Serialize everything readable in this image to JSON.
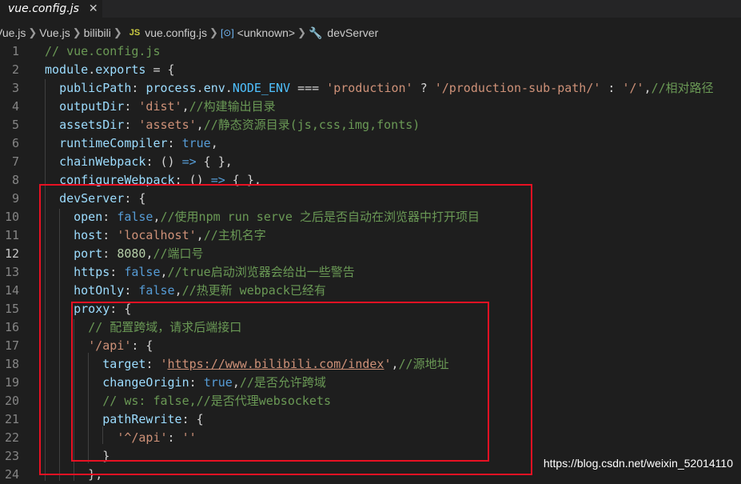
{
  "tab": {
    "title": "vue.config.js",
    "close": "✕"
  },
  "breadcrumb": [
    "Vue.js",
    "Vue.js",
    "bilibili",
    "vue.config.js",
    "<unknown>",
    "devServer"
  ],
  "breadcrumb_icons": {
    "js_badge": "JS",
    "symbol": "[⊙]",
    "wrench": "🔧"
  },
  "active_line": 12,
  "lines": [
    {
      "n": "1",
      "tokens": [
        {
          "t": "// vue.config.js",
          "c": "com"
        }
      ]
    },
    {
      "n": "2",
      "tokens": [
        {
          "t": "module",
          "c": "var"
        },
        {
          "t": ".",
          "c": "p"
        },
        {
          "t": "exports",
          "c": "var"
        },
        {
          "t": " = {",
          "c": "p"
        }
      ]
    },
    {
      "n": "3",
      "tokens": [
        {
          "t": "  ",
          "c": "p"
        },
        {
          "t": "publicPath",
          "c": "var"
        },
        {
          "t": ": ",
          "c": "p"
        },
        {
          "t": "process",
          "c": "var"
        },
        {
          "t": ".",
          "c": "p"
        },
        {
          "t": "env",
          "c": "var"
        },
        {
          "t": ".",
          "c": "p"
        },
        {
          "t": "NODE_ENV",
          "c": "const"
        },
        {
          "t": " === ",
          "c": "p"
        },
        {
          "t": "'production'",
          "c": "str"
        },
        {
          "t": " ? ",
          "c": "p"
        },
        {
          "t": "'/production-sub-path/'",
          "c": "str"
        },
        {
          "t": " : ",
          "c": "p"
        },
        {
          "t": "'/'",
          "c": "str"
        },
        {
          "t": ",",
          "c": "p"
        },
        {
          "t": "//相对路径",
          "c": "com"
        }
      ]
    },
    {
      "n": "4",
      "tokens": [
        {
          "t": "  ",
          "c": "p"
        },
        {
          "t": "outputDir",
          "c": "var"
        },
        {
          "t": ": ",
          "c": "p"
        },
        {
          "t": "'dist'",
          "c": "str"
        },
        {
          "t": ",",
          "c": "p"
        },
        {
          "t": "//构建输出目录",
          "c": "com"
        }
      ]
    },
    {
      "n": "5",
      "tokens": [
        {
          "t": "  ",
          "c": "p"
        },
        {
          "t": "assetsDir",
          "c": "var"
        },
        {
          "t": ": ",
          "c": "p"
        },
        {
          "t": "'assets'",
          "c": "str"
        },
        {
          "t": ",",
          "c": "p"
        },
        {
          "t": "//静态资源目录(js,css,img,fonts)",
          "c": "com"
        }
      ]
    },
    {
      "n": "6",
      "tokens": [
        {
          "t": "  ",
          "c": "p"
        },
        {
          "t": "runtimeCompiler",
          "c": "var"
        },
        {
          "t": ": ",
          "c": "p"
        },
        {
          "t": "true",
          "c": "kw"
        },
        {
          "t": ",",
          "c": "p"
        }
      ]
    },
    {
      "n": "7",
      "tokens": [
        {
          "t": "  ",
          "c": "p"
        },
        {
          "t": "chainWebpack",
          "c": "var"
        },
        {
          "t": ": () ",
          "c": "p"
        },
        {
          "t": "=>",
          "c": "kw"
        },
        {
          "t": " { },",
          "c": "p"
        }
      ]
    },
    {
      "n": "8",
      "tokens": [
        {
          "t": "  ",
          "c": "p"
        },
        {
          "t": "configureWebpack",
          "c": "var"
        },
        {
          "t": ": () ",
          "c": "p"
        },
        {
          "t": "=>",
          "c": "kw"
        },
        {
          "t": " { },",
          "c": "p"
        }
      ]
    },
    {
      "n": "9",
      "tokens": [
        {
          "t": "  ",
          "c": "p"
        },
        {
          "t": "devServer",
          "c": "var"
        },
        {
          "t": ": {",
          "c": "p"
        }
      ]
    },
    {
      "n": "10",
      "tokens": [
        {
          "t": "    ",
          "c": "p"
        },
        {
          "t": "open",
          "c": "var"
        },
        {
          "t": ": ",
          "c": "p"
        },
        {
          "t": "false",
          "c": "kw"
        },
        {
          "t": ",",
          "c": "p"
        },
        {
          "t": "//使用npm run serve 之后是否自动在浏览器中打开项目",
          "c": "com"
        }
      ]
    },
    {
      "n": "11",
      "tokens": [
        {
          "t": "    ",
          "c": "p"
        },
        {
          "t": "host",
          "c": "var"
        },
        {
          "t": ": ",
          "c": "p"
        },
        {
          "t": "'localhost'",
          "c": "str"
        },
        {
          "t": ",",
          "c": "p"
        },
        {
          "t": "//主机名字",
          "c": "com"
        }
      ]
    },
    {
      "n": "12",
      "tokens": [
        {
          "t": "    ",
          "c": "p"
        },
        {
          "t": "port",
          "c": "var"
        },
        {
          "t": ": ",
          "c": "p"
        },
        {
          "t": "8080",
          "c": "num"
        },
        {
          "t": ",",
          "c": "p"
        },
        {
          "t": "//端口号",
          "c": "com"
        }
      ]
    },
    {
      "n": "13",
      "tokens": [
        {
          "t": "    ",
          "c": "p"
        },
        {
          "t": "https",
          "c": "var"
        },
        {
          "t": ": ",
          "c": "p"
        },
        {
          "t": "false",
          "c": "kw"
        },
        {
          "t": ",",
          "c": "p"
        },
        {
          "t": "//true启动浏览器会给出一些警告",
          "c": "com"
        }
      ]
    },
    {
      "n": "14",
      "tokens": [
        {
          "t": "    ",
          "c": "p"
        },
        {
          "t": "hotOnly",
          "c": "var"
        },
        {
          "t": ": ",
          "c": "p"
        },
        {
          "t": "false",
          "c": "kw"
        },
        {
          "t": ",",
          "c": "p"
        },
        {
          "t": "//热更新 webpack已经有",
          "c": "com"
        }
      ]
    },
    {
      "n": "15",
      "tokens": [
        {
          "t": "    ",
          "c": "p"
        },
        {
          "t": "proxy",
          "c": "var"
        },
        {
          "t": ": {",
          "c": "p"
        }
      ]
    },
    {
      "n": "16",
      "tokens": [
        {
          "t": "      ",
          "c": "p"
        },
        {
          "t": "// 配置跨域，请求后端接口",
          "c": "com"
        }
      ]
    },
    {
      "n": "17",
      "tokens": [
        {
          "t": "      ",
          "c": "p"
        },
        {
          "t": "'/api'",
          "c": "str"
        },
        {
          "t": ": {",
          "c": "p"
        }
      ]
    },
    {
      "n": "18",
      "tokens": [
        {
          "t": "        ",
          "c": "p"
        },
        {
          "t": "target",
          "c": "var"
        },
        {
          "t": ": ",
          "c": "p"
        },
        {
          "t": "'",
          "c": "str"
        },
        {
          "t": "https://www.bilibili.com/index",
          "c": "url"
        },
        {
          "t": "'",
          "c": "str"
        },
        {
          "t": ",",
          "c": "p"
        },
        {
          "t": "//源地址",
          "c": "com"
        }
      ]
    },
    {
      "n": "19",
      "tokens": [
        {
          "t": "        ",
          "c": "p"
        },
        {
          "t": "changeOrigin",
          "c": "var"
        },
        {
          "t": ": ",
          "c": "p"
        },
        {
          "t": "true",
          "c": "kw"
        },
        {
          "t": ",",
          "c": "p"
        },
        {
          "t": "//是否允许跨域",
          "c": "com"
        }
      ]
    },
    {
      "n": "20",
      "tokens": [
        {
          "t": "        ",
          "c": "p"
        },
        {
          "t": "// ws: false,//是否代理websockets",
          "c": "com"
        }
      ]
    },
    {
      "n": "21",
      "tokens": [
        {
          "t": "        ",
          "c": "p"
        },
        {
          "t": "pathRewrite",
          "c": "var"
        },
        {
          "t": ": {",
          "c": "p"
        }
      ]
    },
    {
      "n": "22",
      "tokens": [
        {
          "t": "          ",
          "c": "p"
        },
        {
          "t": "'^/api'",
          "c": "str"
        },
        {
          "t": ": ",
          "c": "p"
        },
        {
          "t": "''",
          "c": "str"
        }
      ]
    },
    {
      "n": "23",
      "tokens": [
        {
          "t": "        }",
          "c": "p"
        }
      ]
    },
    {
      "n": "24",
      "tokens": [
        {
          "t": "      },",
          "c": "p"
        }
      ]
    }
  ],
  "watermark": "https://blog.csdn.net/weixin_52014110"
}
